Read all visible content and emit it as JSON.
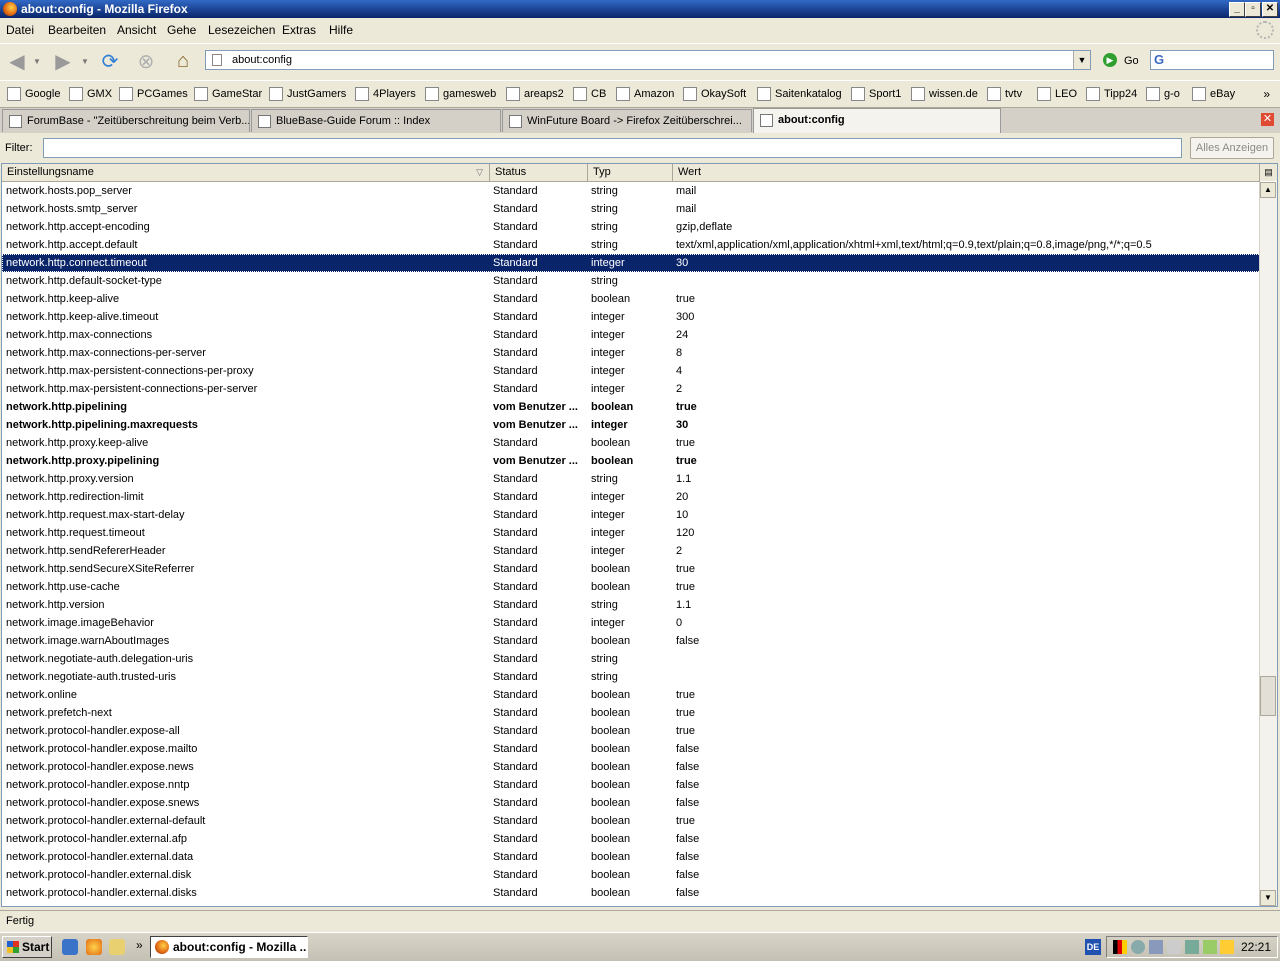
{
  "window": {
    "title": "about:config - Mozilla Firefox",
    "controls": {
      "minimize": "_",
      "maximize": "▫",
      "close": "✕"
    }
  },
  "menu": [
    "Datei",
    "Bearbeiten",
    "Ansicht",
    "Gehe",
    "Lesezeichen",
    "Extras",
    "Hilfe"
  ],
  "navbar": {
    "url": "about:config",
    "go_label": "Go",
    "search_engine_letter": "G"
  },
  "bookmarks": [
    "Google",
    "GMX",
    "PCGames",
    "GameStar",
    "JustGamers",
    "4Players",
    "gamesweb",
    "areaps2",
    "CB",
    "Amazon",
    "OkaySoft",
    "Saitenkatalog",
    "Sport1",
    "wissen.de",
    "tvtv",
    "LEO",
    "Tipp24",
    "g-o",
    "eBay"
  ],
  "bookmarks_more": "»",
  "tabs": [
    "ForumBase - \"Zeitüberschreitung beim Verb...",
    "BlueBase-Guide Forum :: Index",
    "WinFuture Board -> Firefox Zeitüberschrei...",
    "about:config"
  ],
  "active_tab": 3,
  "filter": {
    "label": "Filter:",
    "value": "",
    "button": "Alles Anzeigen"
  },
  "columns": [
    "Einstellungsname",
    "Status",
    "Typ",
    "Wert"
  ],
  "rows": [
    {
      "name": "network.hosts.pop_server",
      "status": "Standard",
      "type": "string",
      "value": "mail"
    },
    {
      "name": "network.hosts.smtp_server",
      "status": "Standard",
      "type": "string",
      "value": "mail"
    },
    {
      "name": "network.http.accept-encoding",
      "status": "Standard",
      "type": "string",
      "value": "gzip,deflate"
    },
    {
      "name": "network.http.accept.default",
      "status": "Standard",
      "type": "string",
      "value": "text/xml,application/xml,application/xhtml+xml,text/html;q=0.9,text/plain;q=0.8,image/png,*/*;q=0.5"
    },
    {
      "name": "network.http.connect.timeout",
      "status": "Standard",
      "type": "integer",
      "value": "30",
      "selected": true
    },
    {
      "name": "network.http.default-socket-type",
      "status": "Standard",
      "type": "string",
      "value": ""
    },
    {
      "name": "network.http.keep-alive",
      "status": "Standard",
      "type": "boolean",
      "value": "true"
    },
    {
      "name": "network.http.keep-alive.timeout",
      "status": "Standard",
      "type": "integer",
      "value": "300"
    },
    {
      "name": "network.http.max-connections",
      "status": "Standard",
      "type": "integer",
      "value": "24"
    },
    {
      "name": "network.http.max-connections-per-server",
      "status": "Standard",
      "type": "integer",
      "value": "8"
    },
    {
      "name": "network.http.max-persistent-connections-per-proxy",
      "status": "Standard",
      "type": "integer",
      "value": "4"
    },
    {
      "name": "network.http.max-persistent-connections-per-server",
      "status": "Standard",
      "type": "integer",
      "value": "2"
    },
    {
      "name": "network.http.pipelining",
      "status": "vom Benutzer ...",
      "type": "boolean",
      "value": "true",
      "modified": true
    },
    {
      "name": "network.http.pipelining.maxrequests",
      "status": "vom Benutzer ...",
      "type": "integer",
      "value": "30",
      "modified": true
    },
    {
      "name": "network.http.proxy.keep-alive",
      "status": "Standard",
      "type": "boolean",
      "value": "true"
    },
    {
      "name": "network.http.proxy.pipelining",
      "status": "vom Benutzer ...",
      "type": "boolean",
      "value": "true",
      "modified": true
    },
    {
      "name": "network.http.proxy.version",
      "status": "Standard",
      "type": "string",
      "value": "1.1"
    },
    {
      "name": "network.http.redirection-limit",
      "status": "Standard",
      "type": "integer",
      "value": "20"
    },
    {
      "name": "network.http.request.max-start-delay",
      "status": "Standard",
      "type": "integer",
      "value": "10"
    },
    {
      "name": "network.http.request.timeout",
      "status": "Standard",
      "type": "integer",
      "value": "120"
    },
    {
      "name": "network.http.sendRefererHeader",
      "status": "Standard",
      "type": "integer",
      "value": "2"
    },
    {
      "name": "network.http.sendSecureXSiteReferrer",
      "status": "Standard",
      "type": "boolean",
      "value": "true"
    },
    {
      "name": "network.http.use-cache",
      "status": "Standard",
      "type": "boolean",
      "value": "true"
    },
    {
      "name": "network.http.version",
      "status": "Standard",
      "type": "string",
      "value": "1.1"
    },
    {
      "name": "network.image.imageBehavior",
      "status": "Standard",
      "type": "integer",
      "value": "0"
    },
    {
      "name": "network.image.warnAboutImages",
      "status": "Standard",
      "type": "boolean",
      "value": "false"
    },
    {
      "name": "network.negotiate-auth.delegation-uris",
      "status": "Standard",
      "type": "string",
      "value": ""
    },
    {
      "name": "network.negotiate-auth.trusted-uris",
      "status": "Standard",
      "type": "string",
      "value": ""
    },
    {
      "name": "network.online",
      "status": "Standard",
      "type": "boolean",
      "value": "true"
    },
    {
      "name": "network.prefetch-next",
      "status": "Standard",
      "type": "boolean",
      "value": "true"
    },
    {
      "name": "network.protocol-handler.expose-all",
      "status": "Standard",
      "type": "boolean",
      "value": "true"
    },
    {
      "name": "network.protocol-handler.expose.mailto",
      "status": "Standard",
      "type": "boolean",
      "value": "false"
    },
    {
      "name": "network.protocol-handler.expose.news",
      "status": "Standard",
      "type": "boolean",
      "value": "false"
    },
    {
      "name": "network.protocol-handler.expose.nntp",
      "status": "Standard",
      "type": "boolean",
      "value": "false"
    },
    {
      "name": "network.protocol-handler.expose.snews",
      "status": "Standard",
      "type": "boolean",
      "value": "false"
    },
    {
      "name": "network.protocol-handler.external-default",
      "status": "Standard",
      "type": "boolean",
      "value": "true"
    },
    {
      "name": "network.protocol-handler.external.afp",
      "status": "Standard",
      "type": "boolean",
      "value": "false"
    },
    {
      "name": "network.protocol-handler.external.data",
      "status": "Standard",
      "type": "boolean",
      "value": "false"
    },
    {
      "name": "network.protocol-handler.external.disk",
      "status": "Standard",
      "type": "boolean",
      "value": "false"
    },
    {
      "name": "network.protocol-handler.external.disks",
      "status": "Standard",
      "type": "boolean",
      "value": "false"
    }
  ],
  "status_text": "Fertig",
  "taskbar": {
    "start": "Start",
    "quicklaunch_more": "»",
    "task": "about:config - Mozilla ...",
    "language": "DE",
    "clock": "22:21"
  },
  "colors": {
    "selection": "#0a246a",
    "titlebar": "#0a246a",
    "chrome": "#ece9d8"
  }
}
